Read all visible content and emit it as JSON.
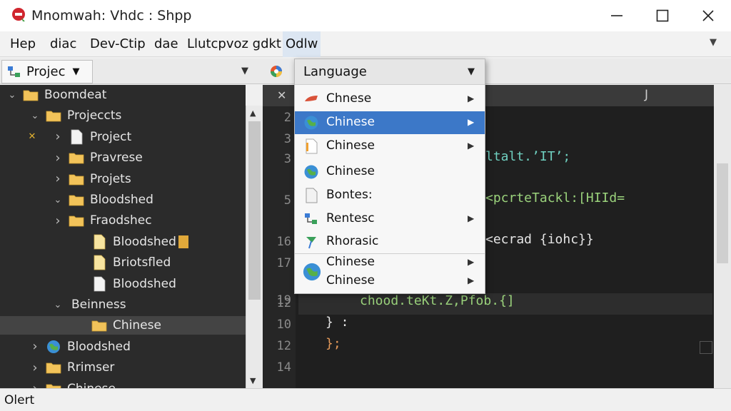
{
  "window": {
    "title": "Mnomwah: Vhdc : Shpp",
    "controls": {
      "minimize": "minimize",
      "maximize": "maximize",
      "close": "close"
    }
  },
  "menubar": {
    "items": [
      {
        "label": "Hep"
      },
      {
        "label": "diac"
      },
      {
        "label": "Dev-Ctip"
      },
      {
        "label": "dae"
      },
      {
        "label": "Llutcpvoz gdkt"
      },
      {
        "label": "Odlw",
        "active": true
      }
    ]
  },
  "left_panel": {
    "tab_label": "Projec",
    "tree": [
      {
        "label": "Boomdeat",
        "twisty": "v",
        "icon": "folder",
        "depth": 0
      },
      {
        "label": "Projeccts",
        "twisty": "v",
        "icon": "folder",
        "depth": 1
      },
      {
        "label": "Project",
        "twisty": ">",
        "icon": "file",
        "depth": 2,
        "marker": "x"
      },
      {
        "label": "Pravrese",
        "twisty": ">",
        "icon": "folder",
        "depth": 2
      },
      {
        "label": "Projets",
        "twisty": ">",
        "icon": "folder",
        "depth": 2
      },
      {
        "label": "Bloodshed",
        "twisty": "v",
        "icon": "folder",
        "depth": 2
      },
      {
        "label": "Fraodshec",
        "twisty": ">",
        "icon": "folder",
        "depth": 2
      },
      {
        "label": "Bloodshed",
        "twisty": "",
        "icon": "file-yellow",
        "depth": 3
      },
      {
        "label": "Briotsfled",
        "twisty": "",
        "icon": "file-yellow",
        "depth": 3
      },
      {
        "label": "Bloodshed",
        "twisty": "",
        "icon": "file",
        "depth": 3
      },
      {
        "label": "Beinness",
        "twisty": "v",
        "icon": "none",
        "depth": 2
      },
      {
        "label": "Chinese",
        "twisty": "",
        "icon": "folder",
        "depth": 3,
        "selected": true
      },
      {
        "label": "Bloodshed",
        "twisty": ">",
        "icon": "folder-globe",
        "depth": 1
      },
      {
        "label": "Rrimser",
        "twisty": ">",
        "icon": "folder",
        "depth": 1
      },
      {
        "label": "Chinese",
        "twisty": ">",
        "icon": "folder",
        "depth": 1
      }
    ]
  },
  "editor": {
    "tab_mark": "J",
    "lines": [
      {
        "no": "2",
        "code": ""
      },
      {
        "no": "3",
        "code": ""
      },
      {
        "no": "3",
        "code": "ltalt.’IT’;"
      },
      {
        "no": "5",
        "code": "<pcrteTackl:[HIId="
      },
      {
        "no": "16",
        "code": "<ecrad {iohc}}"
      },
      {
        "no": "17",
        "code": ""
      },
      {
        "no": "19",
        "code": ""
      },
      {
        "no": "12",
        "code": "chood.teKt.Z,Pfob.{]"
      },
      {
        "no": "10",
        "code": "} :"
      },
      {
        "no": "12",
        "code": "};"
      },
      {
        "no": "14",
        "code": ""
      }
    ]
  },
  "dropdown": {
    "header": "Language",
    "items": [
      {
        "label": "Chnese",
        "icon": "brush-icon",
        "submenu": true
      },
      {
        "label": "Chinese",
        "icon": "globe-icon",
        "submenu": true,
        "highlighted": true
      },
      {
        "label": "Chinese",
        "icon": "document-icon",
        "submenu": true
      },
      {
        "label": "Chinese",
        "icon": "globe-icon",
        "submenu": false
      },
      {
        "label": "Bontes:",
        "icon": "page-icon",
        "submenu": false
      },
      {
        "label": "Rentesc",
        "icon": "network-icon",
        "submenu": true
      },
      {
        "label": "Rhorasic",
        "icon": "pin-icon",
        "submenu": false
      },
      {
        "label": "Chinese",
        "icon": "globe-icon",
        "submenu": true
      },
      {
        "label": "Chinese",
        "icon": "",
        "submenu": true
      }
    ]
  },
  "status": {
    "text": "Olert"
  },
  "colors": {
    "tree_bg": "#2b2b2b",
    "editor_bg": "#1f1f1f",
    "highlight": "#3c78c8",
    "code_green": "#9bd37c",
    "code_teal": "#6fd0c0",
    "code_yellow": "#f0c040",
    "code_orange": "#e59a5a"
  }
}
